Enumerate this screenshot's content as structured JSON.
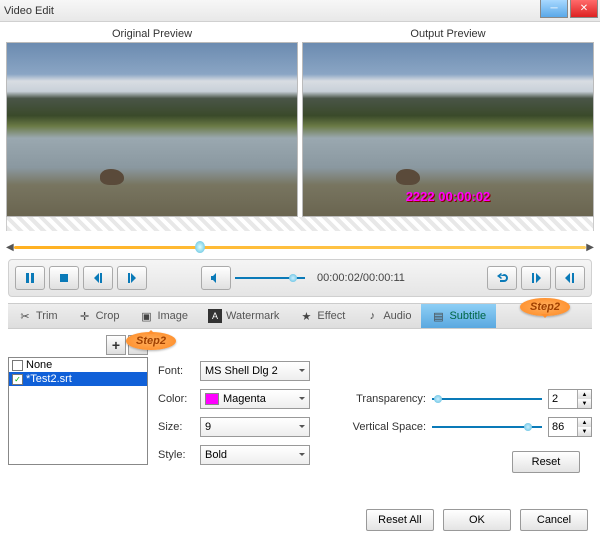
{
  "window": {
    "title": "Video Edit"
  },
  "previews": {
    "original": "Original Preview",
    "output": "Output Preview",
    "subtitle_overlay": "2222 00:00:02"
  },
  "playback": {
    "time": "00:00:02/00:00:11"
  },
  "tabs": {
    "trim": "Trim",
    "crop": "Crop",
    "image": "Image",
    "watermark": "Watermark",
    "effect": "Effect",
    "audio": "Audio",
    "subtitle": "Subtitle"
  },
  "callout": "Step2",
  "addremove": {
    "add": "+",
    "remove": "−"
  },
  "files": {
    "none": "None",
    "item1": "*Test2.srt"
  },
  "props": {
    "font": {
      "label": "Font:",
      "value": "MS Shell Dlg 2"
    },
    "color": {
      "label": "Color:",
      "value": "Magenta"
    },
    "size": {
      "label": "Size:",
      "value": "9"
    },
    "style": {
      "label": "Style:",
      "value": "Bold"
    },
    "transparency": {
      "label": "Transparency:",
      "value": "2"
    },
    "vspace": {
      "label": "Vertical Space:",
      "value": "86"
    }
  },
  "buttons": {
    "reset": "Reset",
    "resetall": "Reset All",
    "ok": "OK",
    "cancel": "Cancel"
  }
}
